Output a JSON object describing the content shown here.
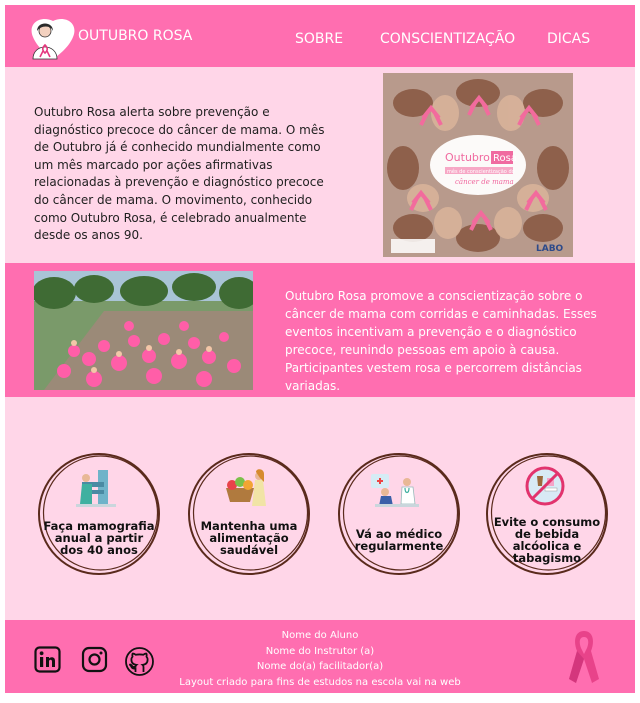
{
  "header": {
    "brand": "OUTUBRO ROSA",
    "nav": [
      "SOBRE",
      "CONSCIENTIZAÇÃO",
      "DICAS"
    ]
  },
  "intro": {
    "text": "Outubro Rosa alerta sobre prevenção e diagnóstico precoce do câncer de mama. O mês de Outubro já é conhecido mundialmente como um mês marcado por ações afirmativas relacionadas à prevenção e diagnóstico precoce do câncer de mama. O movimento, conhecido como Outubro Rosa, é celebrado anualmente desde os anos 90.",
    "image_title_1": "Outubro",
    "image_title_2": "Rosa",
    "image_subtitle": "mês de conscientização do",
    "image_subtitle_2": "câncer de mama",
    "image_logo": "LABO"
  },
  "walk": {
    "text": "Outubro Rosa promove a conscientização sobre o câncer de mama com corridas e caminhadas. Esses eventos incentivam a prevenção e o diagnóstico precoce, reunindo pessoas em apoio à causa. Participantes vestem rosa e percorrem distâncias variadas."
  },
  "tips": [
    {
      "label": "Faça mamografia anual a partir dos 40 anos",
      "icon": "mammography-icon"
    },
    {
      "label": "Mantenha uma alimentação saudável",
      "icon": "healthy-food-icon"
    },
    {
      "label": "Vá ao médico regularmente",
      "icon": "doctor-visit-icon"
    },
    {
      "label": "Evite o consumo de bebida alcóolica e tabagismo",
      "icon": "no-alcohol-tobacco-icon"
    }
  ],
  "footer": {
    "credits": [
      "Nome do Aluno",
      "Nome do Instrutor (a)",
      "Nome do(a) facilitador(a)",
      "Layout criado para fins de estudos na escola vai na web"
    ],
    "social": [
      "linkedin-icon",
      "instagram-icon",
      "github-icon"
    ]
  },
  "colors": {
    "primary": "#ff6eb0",
    "background": "#ffd6e8",
    "ring": "#5a2a1c"
  }
}
